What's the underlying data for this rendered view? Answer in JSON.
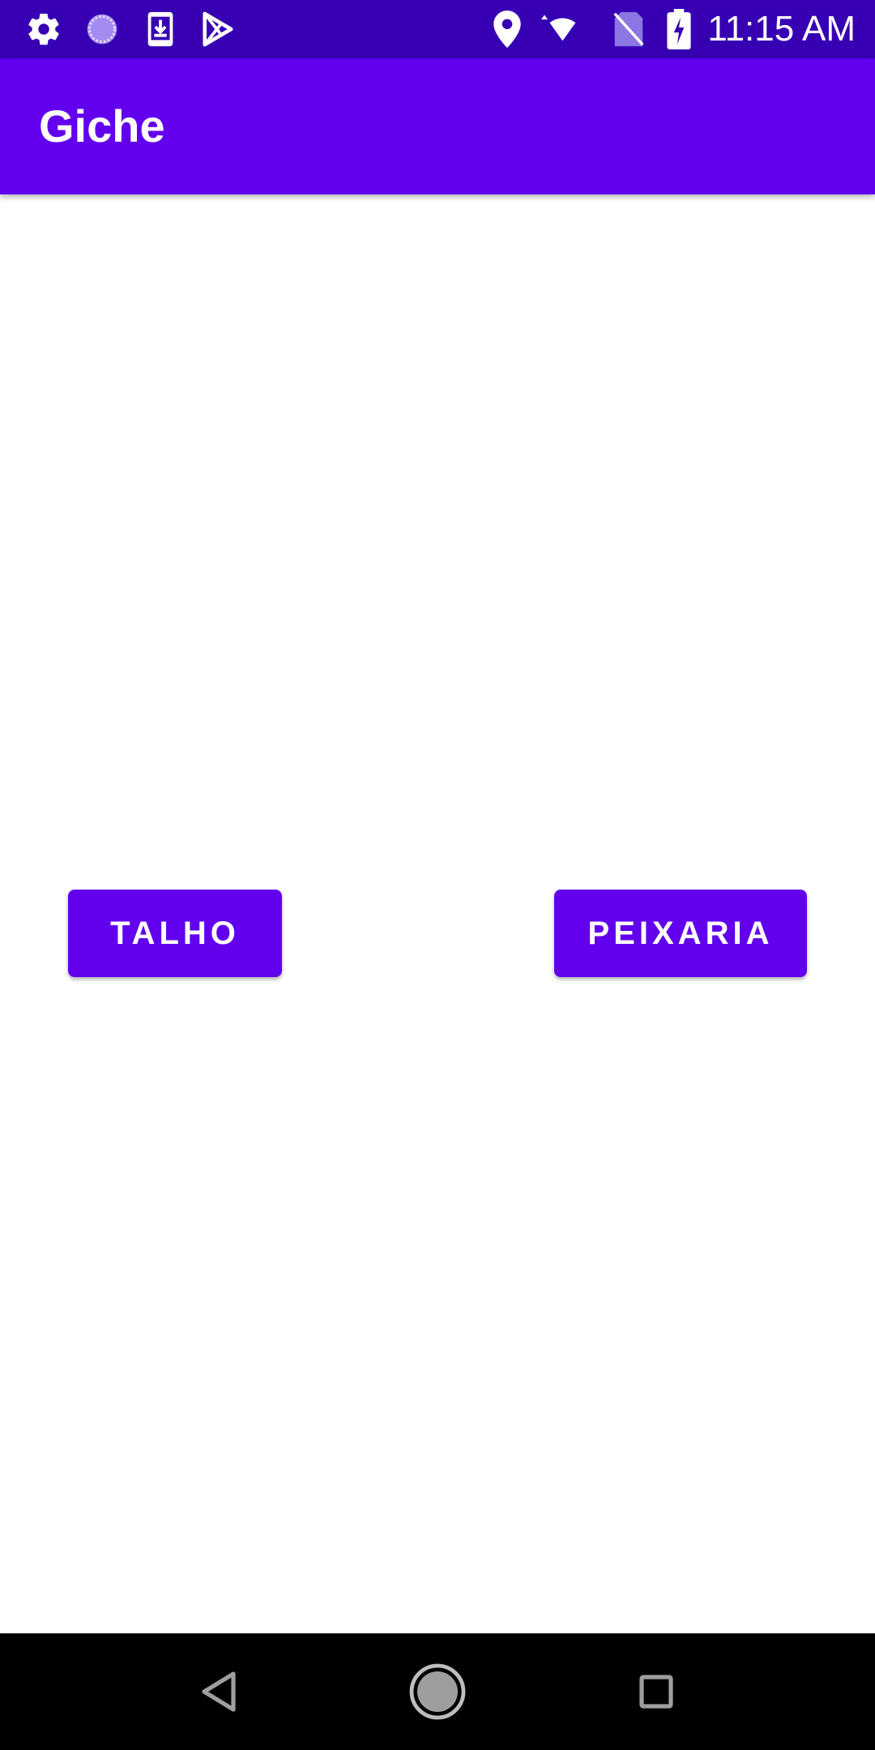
{
  "status_bar": {
    "time": "11:15 AM",
    "left_icons": [
      "gear-icon",
      "loading-circle-icon",
      "download-icon",
      "play-store-icon"
    ],
    "right_icons": [
      "location-icon",
      "wifi-icon",
      "no-sim-icon",
      "battery-charging-icon"
    ]
  },
  "app_bar": {
    "title": "Giche"
  },
  "main": {
    "talho_label": "TALHO",
    "peixaria_label": "PEIXARIA"
  },
  "nav_bar": {
    "icons": [
      "back-icon",
      "home-icon",
      "recents-icon"
    ]
  },
  "colors": {
    "status_bar": "#3700b3",
    "primary": "#6200ee",
    "nav_bar": "#000000",
    "background": "#ffffff"
  }
}
